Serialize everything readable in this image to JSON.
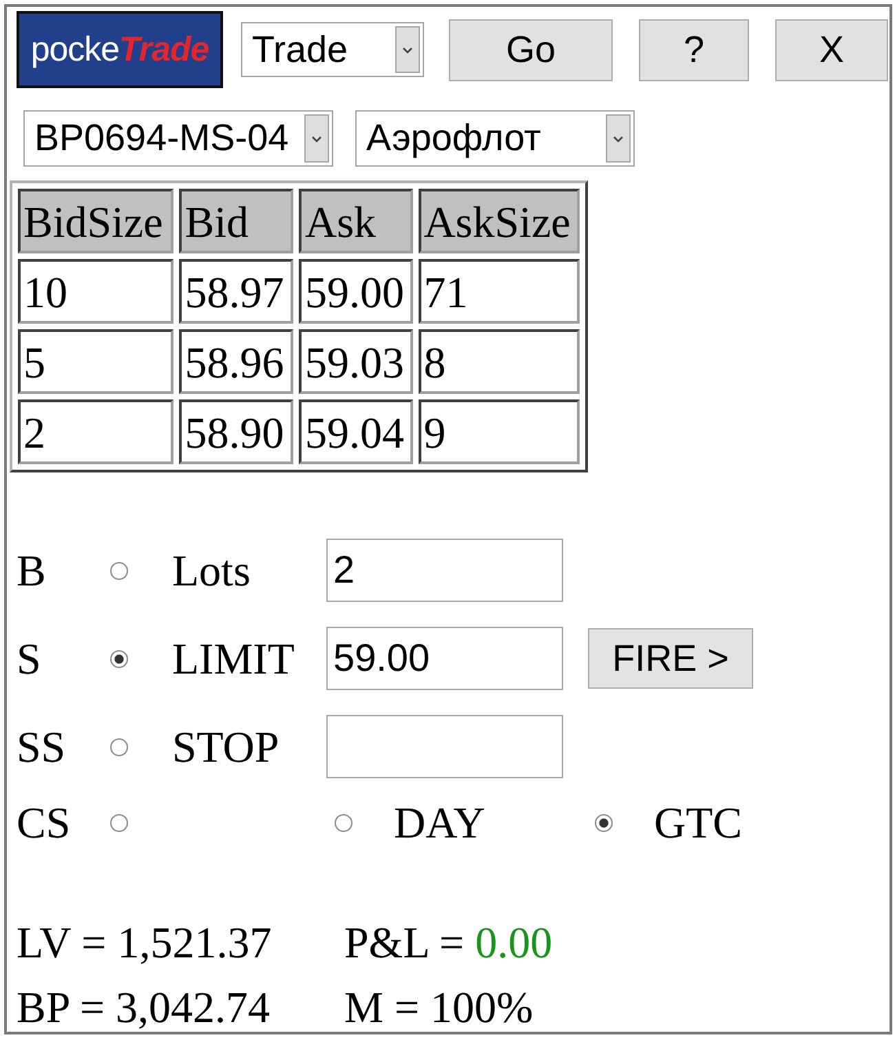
{
  "header": {
    "logo": {
      "text_start": "pocke",
      "text_end": "Trade"
    },
    "mode_select": {
      "value": "Trade"
    },
    "buttons": [
      "Go",
      "?",
      "X"
    ]
  },
  "selectors": {
    "account_select": {
      "value": "BP0694-MS-04"
    },
    "instrument_select": {
      "value": "Аэрофлот"
    }
  },
  "quotes_table": {
    "columns": [
      "BidSize",
      "Bid",
      "Ask",
      "AskSize"
    ],
    "rows": [
      [
        "10",
        "58.97",
        "59.00",
        "71"
      ],
      [
        "5",
        "58.96",
        "59.03",
        "8"
      ],
      [
        "2",
        "58.90",
        "59.04",
        "9"
      ]
    ]
  },
  "order": {
    "sides": [
      {
        "label": "B",
        "selected": false
      },
      {
        "label": "S",
        "selected": true
      },
      {
        "label": "SS",
        "selected": false
      },
      {
        "label": "CS",
        "selected": false
      }
    ],
    "fields": [
      {
        "label": "Lots",
        "value": "2"
      },
      {
        "label": "LIMIT",
        "value": "59.00",
        "button": "FIRE >"
      },
      {
        "label": "STOP"
      }
    ],
    "durations": [
      {
        "label": "DAY",
        "selected": false
      },
      {
        "label": "GTC",
        "selected": true
      }
    ]
  },
  "summary": [
    {
      "kind": "plain",
      "label": "LV =",
      "value": "1,521.37"
    },
    {
      "kind": "pnl",
      "label": "P&L =",
      "value": "0.00"
    },
    {
      "kind": "plain",
      "label": "BP =",
      "value": "3,042.74"
    },
    {
      "kind": "plain",
      "label": "M =",
      "value": "100%"
    }
  ]
}
